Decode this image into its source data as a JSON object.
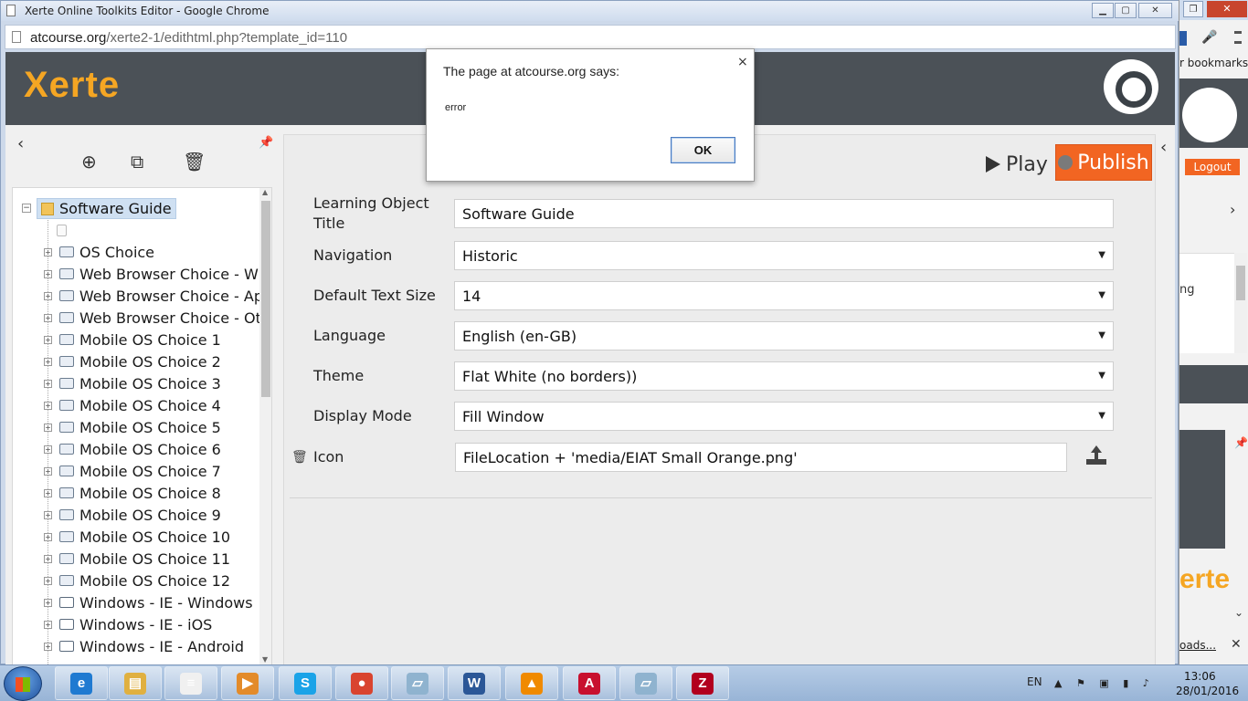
{
  "window": {
    "title": "Xerte Online Toolkits Editor - Google Chrome",
    "btn_min": "▁",
    "btn_max": "▢",
    "btn_close": "✕"
  },
  "address_bar": {
    "host": "atcourse.org",
    "path": "/xerte2-1/edithtml.php?template_id=110"
  },
  "header": {
    "logo": "Xerte"
  },
  "left_toolbar": {
    "collapse": "‹",
    "pin": "📌",
    "add": "⊕",
    "duplicate": "⧉",
    "delete": "🗑"
  },
  "tree": {
    "root": "Software Guide",
    "items": [
      "",
      "OS Choice",
      "Web Browser Choice - Wi",
      "Web Browser Choice - Ap",
      "Web Browser Choice - Ot",
      "Mobile OS Choice 1",
      "Mobile OS Choice 2",
      "Mobile OS Choice 3",
      "Mobile OS Choice 4",
      "Mobile OS Choice 5",
      "Mobile OS Choice 6",
      "Mobile OS Choice 7",
      "Mobile OS Choice 8",
      "Mobile OS Choice 9",
      "Mobile OS Choice 10",
      "Mobile OS Choice 11",
      "Mobile OS Choice 12",
      "Windows - IE - Windows",
      "Windows - IE - iOS",
      "Windows - IE - Android"
    ]
  },
  "main": {
    "play_label": "Play",
    "publish_label": "Publish",
    "properties": [
      {
        "label": "Learning Object Title",
        "value": "Software Guide",
        "dropdown": false
      },
      {
        "label": "Navigation",
        "value": "Historic",
        "dropdown": true
      },
      {
        "label": "Default Text Size",
        "value": "14",
        "dropdown": true
      },
      {
        "label": "Language",
        "value": "English (en-GB)",
        "dropdown": true
      },
      {
        "label": "Theme",
        "value": "Flat White (no borders))",
        "dropdown": true
      },
      {
        "label": "Display Mode",
        "value": "Fill Window",
        "dropdown": true
      }
    ],
    "icon_label": "Icon",
    "icon_value": "FileLocation + 'media/EIAT Small Orange.png'",
    "dropdown_caret": "▼"
  },
  "dialog": {
    "title": "The page at atcourse.org says:",
    "message": "error",
    "ok_label": "OK",
    "close": "×"
  },
  "background_window": {
    "bookmarks": "r bookmarks",
    "logout": "Logout",
    "partial_text": "ng",
    "logo_partial": "erte",
    "downloads": "oads..."
  },
  "taskbar": {
    "apps": [
      {
        "name": "ie-icon",
        "glyph": "e",
        "color": "#1f7ad1"
      },
      {
        "name": "explorer-icon",
        "glyph": "▤",
        "color": "#e0b040"
      },
      {
        "name": "notepad-icon",
        "glyph": "≡",
        "color": "#f0f0f0"
      },
      {
        "name": "media-player-icon",
        "glyph": "▶",
        "color": "#e38b2a"
      },
      {
        "name": "skype-icon",
        "glyph": "S",
        "color": "#1aa3e8"
      },
      {
        "name": "chrome-icon",
        "glyph": "●",
        "color": "#d9442f"
      },
      {
        "name": "tablet-icon",
        "glyph": "▱",
        "color": "#8fb3cf"
      },
      {
        "name": "word-icon",
        "glyph": "W",
        "color": "#2b5797"
      },
      {
        "name": "vlc-icon",
        "glyph": "▲",
        "color": "#f08a00"
      },
      {
        "name": "acrobat-icon",
        "glyph": "A",
        "color": "#c8102e"
      },
      {
        "name": "tablet2-icon",
        "glyph": "▱",
        "color": "#8fb3cf"
      },
      {
        "name": "filezilla-icon",
        "glyph": "Z",
        "color": "#b2001e"
      }
    ],
    "lang": "EN",
    "time": "13:06",
    "date": "28/01/2016"
  }
}
